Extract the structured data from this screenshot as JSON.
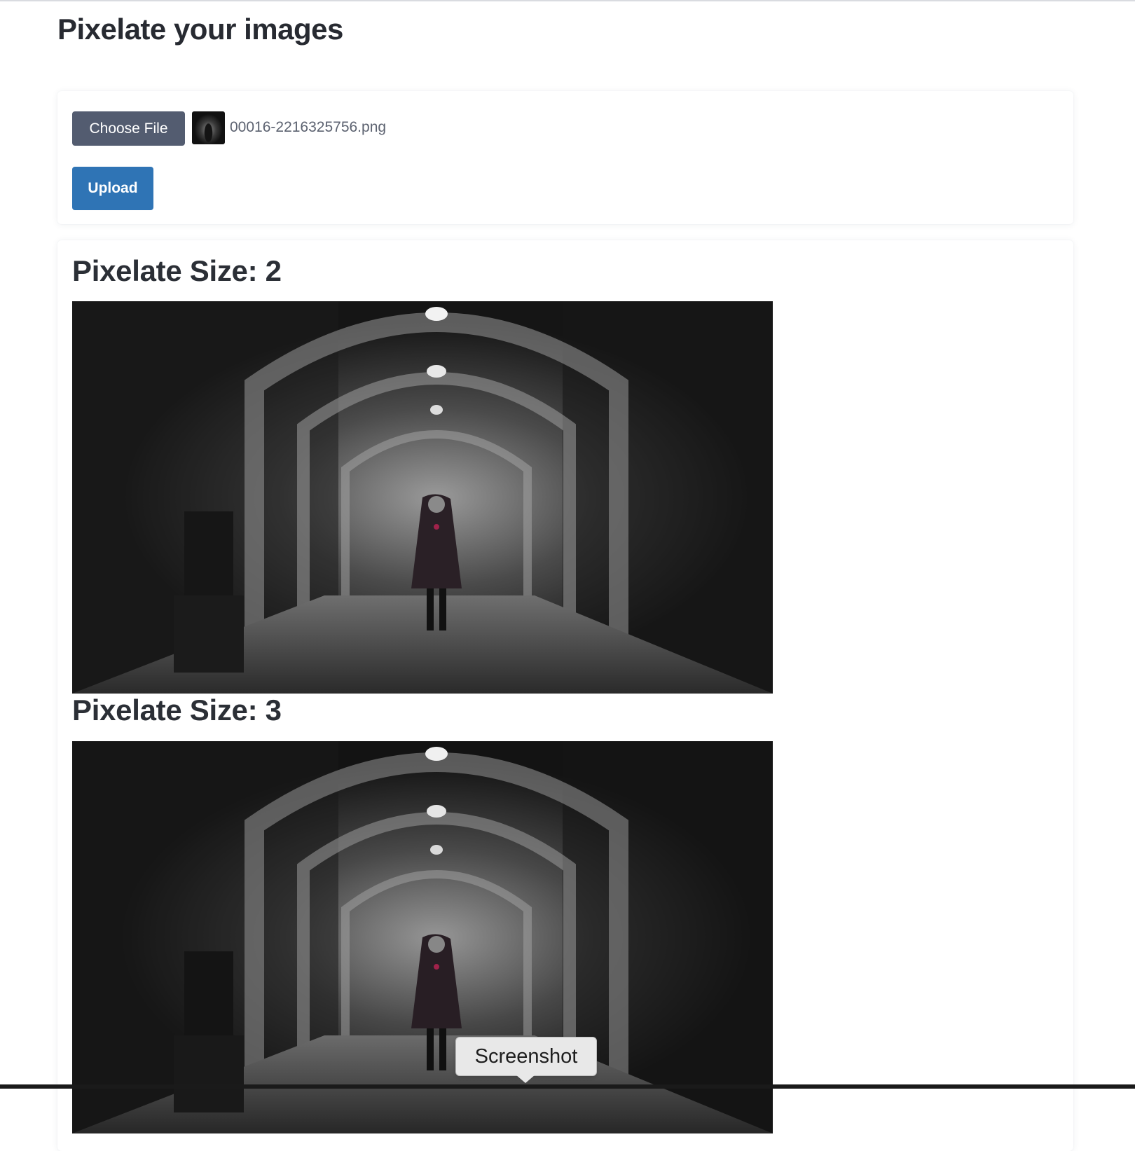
{
  "page": {
    "title": "Pixelate your images"
  },
  "upload": {
    "choose_file_label": "Choose File",
    "file_name": "00016-2216325756.png",
    "upload_label": "Upload"
  },
  "results": [
    {
      "heading": "Pixelate Size: 2"
    },
    {
      "heading": "Pixelate Size: 3"
    }
  ],
  "tooltip": {
    "label": "Screenshot"
  },
  "colors": {
    "choose_button": "#535c70",
    "upload_button": "#2f74b5",
    "heading_text": "#2b2f36"
  }
}
